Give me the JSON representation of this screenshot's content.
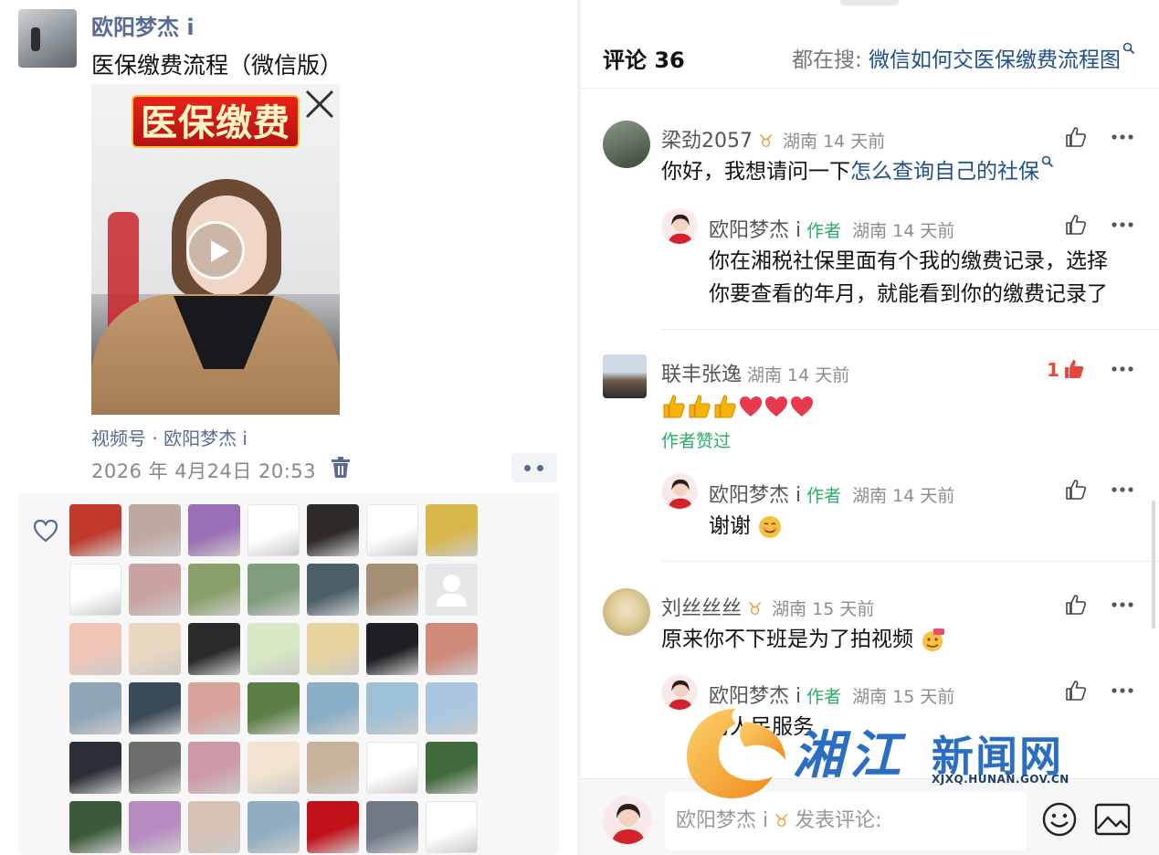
{
  "post": {
    "author": "欧阳梦杰 i",
    "title": "医保缴费流程（微信版）",
    "video_banner": "医保缴费",
    "channel": "视频号 · 欧阳梦杰 i",
    "date": "2026 年 4月24日 20:53"
  },
  "likers": {
    "count_visible": 42,
    "colors": [
      "#c0392b",
      "#bfa8a0",
      "#9b6fb5",
      "#ffffff",
      "#2d2a28",
      "#ffffff",
      "#d8b74a",
      "#ffffff",
      "#c9a3a0",
      "#8aa06a",
      "#7f9c7d",
      "#4c5f67",
      "#a58f75",
      "blank",
      "#f0c6b8",
      "#e9d7c1",
      "#2a2a2a",
      "#d9e8c4",
      "#e7d4a1",
      "#1e1f22",
      "#cf8a7b",
      "#8fa5b8",
      "#3a4a57",
      "#d7a39b",
      "#5d7f46",
      "#89aec5",
      "#9fc1d7",
      "#aac7df",
      "#2b2f36",
      "#6b6e6a",
      "#cf9aa7",
      "#f1e3cf",
      "#c7b39b",
      "#ffffff",
      "#3f6a3c",
      "#3b5a3a",
      "#b78ac2",
      "#d7c1b5",
      "#91aec1",
      "#c1121a",
      "#6f7a86",
      "#ffffff"
    ]
  },
  "comments_header": {
    "label": "评论 36",
    "searching_label": "都在搜: ",
    "searching_term": "微信如何交医保缴费流程图"
  },
  "comments": [
    {
      "name": "梁劲2057",
      "vip": "♉",
      "location": "湖南 14 天前",
      "text_plain": "你好，我想请问一下",
      "text_link": "怎么查询自己的社保",
      "avatar_color": "#4a5a4a"
    },
    {
      "name": "欧阳梦杰 i",
      "badge": "作者",
      "location": "湖南 14 天前",
      "text_line1": "你在湘税社保里面有个我的缴费记录，选择",
      "text_line2": "你要查看的年月，就能看到你的缴费记录了"
    },
    {
      "name": "联丰张逸",
      "location": "湖南 14 天前",
      "likes": "1",
      "author_liked": "作者赞过"
    },
    {
      "name": "欧阳梦杰 i",
      "badge": "作者",
      "location": "湖南 14 天前",
      "text": "谢谢"
    },
    {
      "name": "刘丝丝丝",
      "vip": "♉",
      "location": "湖南 15 天前",
      "text": "原来你不下班是为了拍视频"
    },
    {
      "name": "欧阳梦杰 i",
      "badge": "作者",
      "location": "湖南 15 天前",
      "text": "为人民服务"
    }
  ],
  "composer": {
    "name": "欧阳梦杰 i",
    "vip": "♉",
    "placeholder": "发表评论:"
  },
  "watermark": {
    "script": "湘江",
    "title": "新闻网",
    "url": "XJXQ.HUNAN.GOV.CN"
  },
  "colors": {
    "link": "#576b95",
    "author_badge": "#2aae67",
    "like_red": "#e8473c",
    "vip_gold": "#e8a23a"
  }
}
